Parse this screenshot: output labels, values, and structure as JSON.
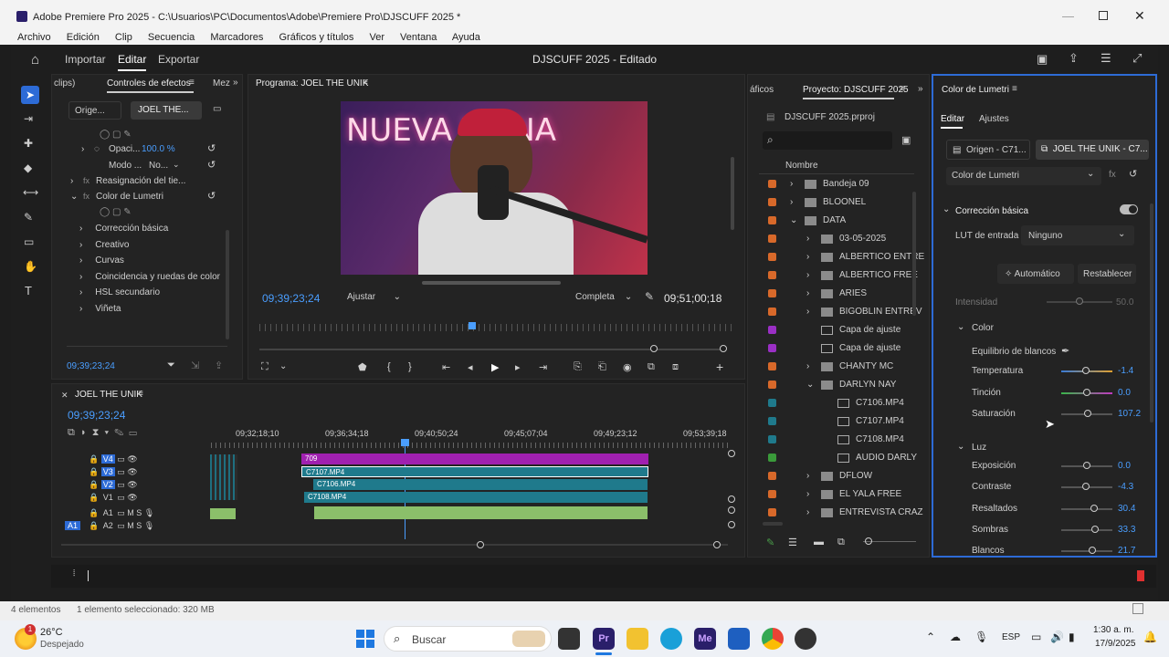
{
  "window": {
    "title": "Adobe Premiere Pro 2025 - C:\\Usuarios\\PC\\Documentos\\Adobe\\Premiere Pro\\DJSCUFF 2025 *"
  },
  "menu": [
    "Archivo",
    "Edición",
    "Clip",
    "Secuencia",
    "Marcadores",
    "Gráficos y títulos",
    "Ver",
    "Ventana",
    "Ayuda"
  ],
  "header": {
    "import": "Importar",
    "edit": "Editar",
    "export": "Exportar",
    "project_title": "DJSCUFF 2025 - Editado"
  },
  "effects_panel": {
    "tab_clips": "clips)",
    "tab_title": "Controles de efectos",
    "tab_mez": "Mez",
    "source_tab": "Orige...",
    "seq_tab": "JOEL THE...",
    "opacity_label": "Opaci...",
    "opacity_value": "100.0 %",
    "mode_label": "Modo ...",
    "mode_value": "No...",
    "time_remap": "Reasignación del tie...",
    "lumetri": "Color de Lumetri",
    "items": [
      "Corrección básica",
      "Creativo",
      "Curvas",
      "Coincidencia y ruedas de color",
      "HSL secundario",
      "Viñeta"
    ],
    "timecode": "09;39;23;24"
  },
  "program": {
    "title": "Programa: JOEL THE UNIK",
    "neon_text": "NUEVA VAINA",
    "timecode": "09;39;23;24",
    "fit": "Ajustar",
    "quality": "Completa",
    "duration": "09;51;00;18"
  },
  "project": {
    "tab_prev": "áficos",
    "title": "Proyecto: DJSCUFF 2025",
    "file": "DJSCUFF 2025.prproj",
    "column": "Nombre",
    "items": [
      {
        "label": "Bandeja 09",
        "color": "#d8692a",
        "indent": 0,
        "type": "folder",
        "arrow": ">"
      },
      {
        "label": "BLOONEL",
        "color": "#d8692a",
        "indent": 0,
        "type": "folder",
        "arrow": ">"
      },
      {
        "label": "DATA",
        "color": "#d8692a",
        "indent": 0,
        "type": "folder",
        "arrow": "v"
      },
      {
        "label": "03-05-2025",
        "color": "#d8692a",
        "indent": 1,
        "type": "folder",
        "arrow": ">"
      },
      {
        "label": "ALBERTICO ENTRE",
        "color": "#d8692a",
        "indent": 1,
        "type": "folder",
        "arrow": ">"
      },
      {
        "label": "ALBERTICO FREE",
        "color": "#d8692a",
        "indent": 1,
        "type": "folder",
        "arrow": ">"
      },
      {
        "label": "ARIES",
        "color": "#d8692a",
        "indent": 1,
        "type": "folder",
        "arrow": ">"
      },
      {
        "label": "BIGOBLIN ENTREV",
        "color": "#d8692a",
        "indent": 1,
        "type": "folder",
        "arrow": ">"
      },
      {
        "label": "Capa de ajuste",
        "color": "#9a2fc5",
        "indent": 1,
        "type": "adjust",
        "arrow": ""
      },
      {
        "label": "Capa de ajuste",
        "color": "#9a2fc5",
        "indent": 1,
        "type": "adjust",
        "arrow": ""
      },
      {
        "label": "CHANTY MC",
        "color": "#d8692a",
        "indent": 1,
        "type": "folder",
        "arrow": ">"
      },
      {
        "label": "DARLYN NAY",
        "color": "#d8692a",
        "indent": 1,
        "type": "folder",
        "arrow": "v"
      },
      {
        "label": "C7106.MP4",
        "color": "#1f7a8c",
        "indent": 2,
        "type": "clip",
        "arrow": ""
      },
      {
        "label": "C7107.MP4",
        "color": "#1f7a8c",
        "indent": 2,
        "type": "clip",
        "arrow": ""
      },
      {
        "label": "C7108.MP4",
        "color": "#1f7a8c",
        "indent": 2,
        "type": "clip",
        "arrow": ""
      },
      {
        "label": "AUDIO DARLY",
        "color": "#3a9a3a",
        "indent": 2,
        "type": "audio",
        "arrow": ""
      },
      {
        "label": "DFLOW",
        "color": "#d8692a",
        "indent": 1,
        "type": "folder",
        "arrow": ">"
      },
      {
        "label": "EL YALA FREE",
        "color": "#d8692a",
        "indent": 1,
        "type": "folder",
        "arrow": ">"
      },
      {
        "label": "ENTREVISTA CRAZ",
        "color": "#d8692a",
        "indent": 1,
        "type": "folder",
        "arrow": ">"
      }
    ]
  },
  "lumetri": {
    "title": "Color de Lumetri",
    "tab_edit": "Editar",
    "tab_settings": "Ajustes",
    "source": "Origen - C71...",
    "seq": "JOEL THE UNIK - C7...",
    "effect": "Color de Lumetri",
    "section_basic": "Corrección básica",
    "lut_label": "LUT de entrada",
    "lut_value": "Ninguno",
    "auto": "Automático",
    "reset": "Restablecer",
    "intensity_label": "Intensidad",
    "intensity_value": "50.0",
    "color_section": "Color",
    "wb_label": "Equilibrio de blancos",
    "light_section": "Luz",
    "sliders": [
      {
        "label": "Temperatura",
        "value": "-1.4",
        "pos": 0.48,
        "type": "temp"
      },
      {
        "label": "Tinción",
        "value": "0.0",
        "pos": 0.5,
        "type": "tint"
      },
      {
        "label": "Saturación",
        "value": "107.2",
        "pos": 0.52,
        "type": "plain"
      }
    ],
    "light_sliders": [
      {
        "label": "Exposición",
        "value": "0.0",
        "pos": 0.5
      },
      {
        "label": "Contraste",
        "value": "-4.3",
        "pos": 0.48
      },
      {
        "label": "Resaltados",
        "value": "30.4",
        "pos": 0.65
      },
      {
        "label": "Sombras",
        "value": "33.3",
        "pos": 0.66
      },
      {
        "label": "Blancos",
        "value": "21.7",
        "pos": 0.61
      }
    ]
  },
  "timeline": {
    "title": "JOEL THE UNIK",
    "timecode": "09;39;23;24",
    "ruler": [
      "09;32;18;10",
      "09;36;34;18",
      "09;40;50;24",
      "09;45;07;04",
      "09;49;23;12",
      "09;53;39;18"
    ],
    "tracks_video": [
      "V4",
      "V3",
      "V2",
      "V1"
    ],
    "tracks_audio": [
      "A1",
      "A2"
    ],
    "clips": {
      "v4": "709",
      "v3": "C7107.MP4",
      "v2": "C7106.MP4",
      "v1": "C7108.MP4"
    }
  },
  "status": {
    "left": "4 elementos",
    "selected": "1 elemento seleccionado: 320 MB"
  },
  "taskbar": {
    "weather_temp": "26°C",
    "weather_desc": "Despejado",
    "search": "Buscar",
    "lang": "ESP",
    "time": "1:30 a. m.",
    "date": "17/9/2025"
  }
}
